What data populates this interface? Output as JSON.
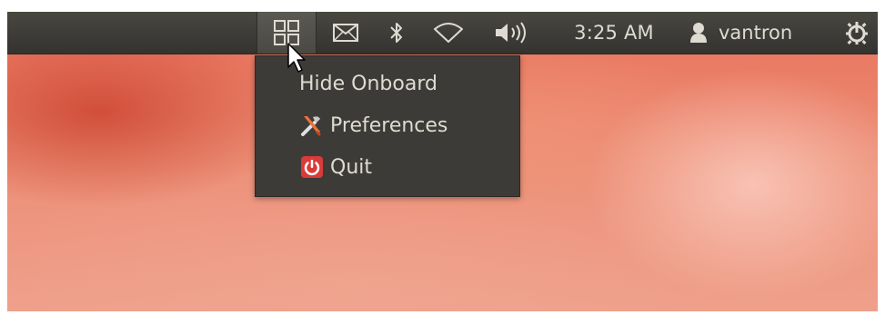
{
  "panel": {
    "indicators": {
      "onboard_icon": "onboard-keyboard-icon",
      "mail_icon": "mail-envelope-icon",
      "bluetooth_icon": "bluetooth-icon",
      "network_icon": "wifi-icon",
      "volume_icon": "volume-speaker-icon",
      "user_icon": "user-person-icon",
      "session_icon": "power-gear-icon"
    },
    "clock": "3:25 AM",
    "user_name": "vantron"
  },
  "menu": {
    "items": [
      {
        "label": "Hide Onboard",
        "icon": null
      },
      {
        "label": "Preferences",
        "icon": "tools-icon"
      },
      {
        "label": "Quit",
        "icon": "power-quit-icon"
      }
    ]
  },
  "colors": {
    "panel_bg": "#3c3b37",
    "panel_text": "#dfdbd2",
    "menu_bg": "#3c3b37",
    "quit_icon_red": "#d93a3a",
    "wallpaper_orange": "#e9705a"
  }
}
